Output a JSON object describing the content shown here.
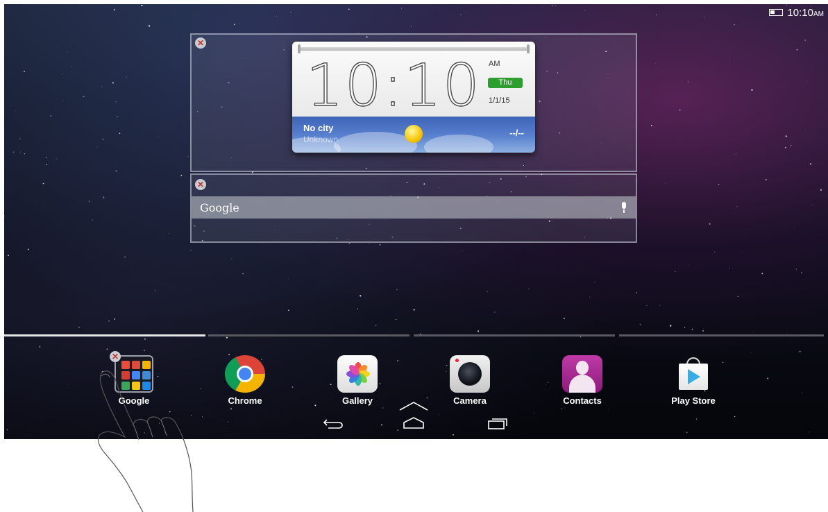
{
  "status_bar": {
    "time": "10:10",
    "ampm": "AM"
  },
  "clock_widget": {
    "time": "10:10",
    "ampm": "AM",
    "day": "Thu",
    "date": "1/1/15",
    "city": "No city",
    "city_status": "Unknown",
    "temperature": "--/--"
  },
  "search_widget": {
    "label": "Google"
  },
  "dock": {
    "items": [
      {
        "label": "Google",
        "icon": "google-folder-icon"
      },
      {
        "label": "Chrome",
        "icon": "chrome-icon"
      },
      {
        "label": "Gallery",
        "icon": "gallery-icon"
      },
      {
        "label": "Camera",
        "icon": "camera-icon"
      },
      {
        "label": "Contacts",
        "icon": "contacts-icon"
      },
      {
        "label": "Play Store",
        "icon": "play-store-icon"
      }
    ]
  },
  "page_indicator": {
    "pages": 4,
    "current": 1
  },
  "nav_bar": {
    "buttons": [
      "back",
      "home",
      "recents"
    ]
  },
  "colors": {
    "day_badge": "#2e9e2e",
    "close_badge": "#c0392b",
    "weather_band": "#3d63b8"
  }
}
